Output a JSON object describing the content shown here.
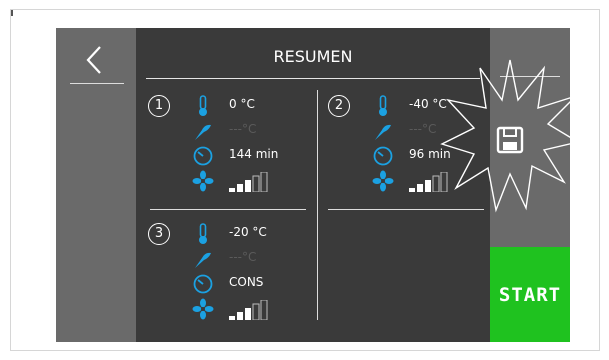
{
  "screen": {
    "title": "RESUMEN",
    "start_label": "START"
  },
  "colors": {
    "panel": "#3a3a3a",
    "rail": "#6a6a6a",
    "icon_blue": "#1ba1e2",
    "start_green": "#1fc21f"
  },
  "icons": {
    "back": "chevron-left-icon",
    "save": "floppy-disk-icon",
    "temperature": "thermometer-icon",
    "probe": "core-probe-icon",
    "time": "clock-icon",
    "fan": "fan-icon"
  },
  "phases": [
    {
      "number": "1",
      "temperature": "0 °C",
      "probe": "---°C",
      "time": "144 min",
      "fan_level": 3,
      "fan_max": 5
    },
    {
      "number": "2",
      "temperature": "-40 °C",
      "probe": "---°C",
      "time": "96 min",
      "fan_level": 3,
      "fan_max": 5
    },
    {
      "number": "3",
      "temperature": "-20 °C",
      "probe": "---°C",
      "time": "CONS",
      "fan_level": 3,
      "fan_max": 5
    }
  ]
}
